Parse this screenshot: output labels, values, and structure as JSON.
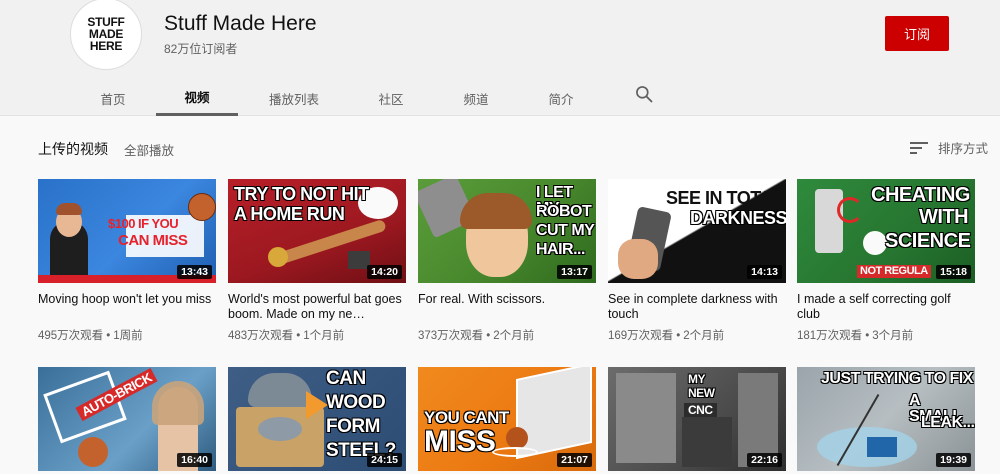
{
  "channel": {
    "avatar_lines": [
      "STUFF",
      "MADE",
      "HERE"
    ],
    "name": "Stuff Made Here",
    "subscribers": "82万位订阅者",
    "subscribe_label": "订阅"
  },
  "tabs": [
    {
      "label": "首页",
      "active": false
    },
    {
      "label": "视频",
      "active": true
    },
    {
      "label": "播放列表",
      "active": false
    },
    {
      "label": "社区",
      "active": false
    },
    {
      "label": "频道",
      "active": false
    },
    {
      "label": "简介",
      "active": false
    }
  ],
  "section": {
    "title": "上传的视频",
    "play_all": "全部播放",
    "sort_label": "排序方式"
  },
  "videos": [
    {
      "thumb_text": [
        "$100 IF YOU",
        "CAN MISS"
      ],
      "duration": "13:43",
      "title": "Moving hoop won't let you miss",
      "views": "495万次观看",
      "age": "1周前"
    },
    {
      "thumb_text": [
        "TRY TO NOT HIT",
        "A HOME RUN"
      ],
      "duration": "14:20",
      "title": "World's most powerful bat goes boom. Made on my ne…",
      "views": "483万次观看",
      "age": "1个月前"
    },
    {
      "thumb_text": [
        "I LET MY",
        "ROBOT",
        "CUT MY",
        "HAIR..."
      ],
      "duration": "13:17",
      "title": "For real. With scissors.",
      "views": "373万次观看",
      "age": "2个月前"
    },
    {
      "thumb_text": [
        "SEE IN TOTAL",
        "DARKNESS"
      ],
      "duration": "14:13",
      "title": "See in complete darkness with touch",
      "views": "169万次观看",
      "age": "2个月前"
    },
    {
      "thumb_text": [
        "CHEATING",
        "WITH",
        "SCIENCE"
      ],
      "thumb_badge": "NOT REGULA",
      "duration": "15:18",
      "title": "I made a self correcting golf club",
      "views": "181万次观看",
      "age": "3个月前"
    },
    {
      "thumb_text": [
        "Auto-BRICK"
      ],
      "duration": "16:40"
    },
    {
      "thumb_text": [
        "CAN",
        "WOOD",
        "FORM",
        "STEEL?"
      ],
      "duration": "24:15"
    },
    {
      "thumb_text": [
        "YOU CANT",
        "MISS"
      ],
      "duration": "21:07"
    },
    {
      "thumb_text": [
        "MY",
        "NEW",
        "CNC"
      ],
      "duration": "22:16"
    },
    {
      "thumb_text": [
        "JUST TRYING TO FIX",
        "A SMALL",
        "LEAK..."
      ],
      "duration": "19:39"
    }
  ]
}
